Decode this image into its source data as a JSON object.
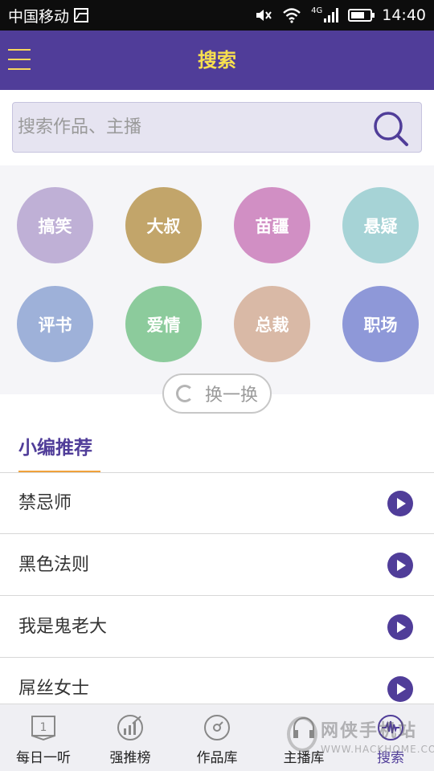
{
  "status_bar": {
    "carrier": "中国移动",
    "network": "4G",
    "time": "14:40"
  },
  "header": {
    "title": "搜索"
  },
  "search": {
    "placeholder": "搜索作品、主播"
  },
  "tags": [
    {
      "label": "搞笑",
      "color": "#bfb0d6"
    },
    {
      "label": "大叔",
      "color": "#c2a56a"
    },
    {
      "label": "苗疆",
      "color": "#d18fc4"
    },
    {
      "label": "悬疑",
      "color": "#a6d3d6"
    },
    {
      "label": "评书",
      "color": "#9eb1d9"
    },
    {
      "label": "爱情",
      "color": "#8ccb9c"
    },
    {
      "label": "总裁",
      "color": "#d9b9a6"
    },
    {
      "label": "职场",
      "color": "#8e98d8"
    }
  ],
  "refresh_label": "换一换",
  "recommend": {
    "title": "小编推荐",
    "items": [
      {
        "title": "禁忌师"
      },
      {
        "title": "黑色法则"
      },
      {
        "title": "我是鬼老大"
      },
      {
        "title": "屌丝女士"
      }
    ]
  },
  "bottom_nav": [
    {
      "label": "每日一听",
      "icon": "book-icon"
    },
    {
      "label": "强推榜",
      "icon": "chart-icon"
    },
    {
      "label": "作品库",
      "icon": "disc-icon"
    },
    {
      "label": "主播库",
      "icon": "headphones-icon"
    },
    {
      "label": "搜索",
      "icon": "waveform-icon",
      "active": true
    }
  ],
  "watermark": {
    "text": "网侠手机站",
    "url": "WWW.HACKHOME.COM"
  },
  "colors": {
    "brand": "#503d99",
    "accent": "#f8e04e",
    "underline": "#f0a23b"
  }
}
